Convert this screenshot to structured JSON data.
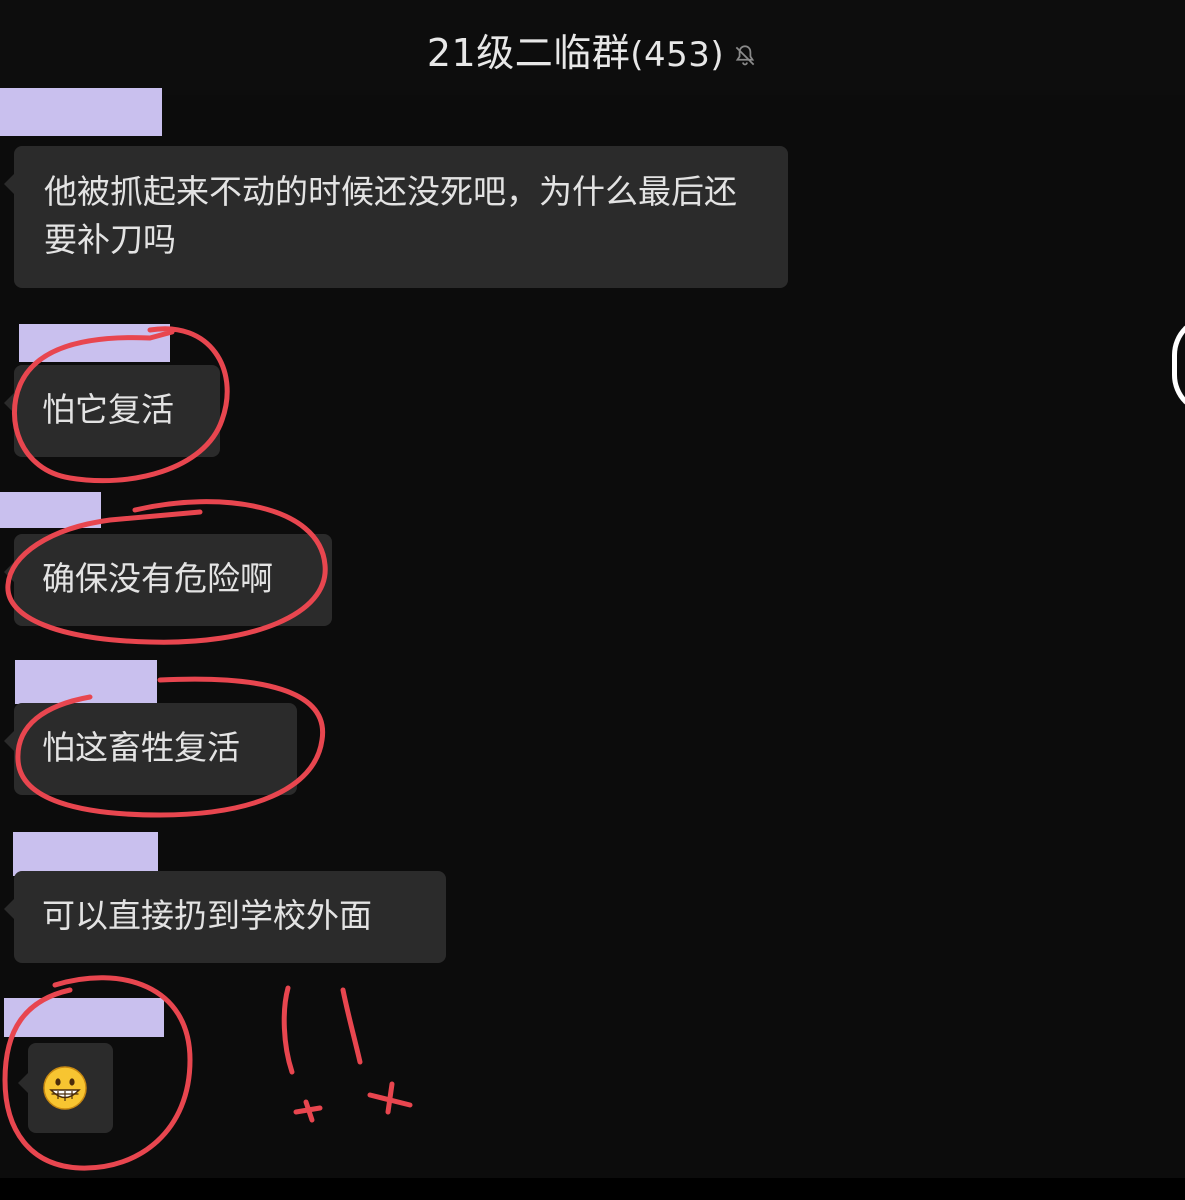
{
  "header": {
    "group_name": "21级二临群",
    "member_count": "(453)",
    "mute_icon": "bell-off-icon"
  },
  "messages": [
    {
      "text": "他被抓起来不动的时候还没死吧，为什么最后还要补刀吗"
    },
    {
      "text": "怕它复活"
    },
    {
      "text": "确保没有危险啊"
    },
    {
      "text": "怕这畜牲复活"
    },
    {
      "text": "可以直接扔到学校外面"
    },
    {
      "emoji": "grinning-face-icon"
    }
  ],
  "colors": {
    "background": "#0c0c0c",
    "bubble": "#2b2b2b",
    "name_mask": "#c9c0ee",
    "annotation": "#e8464f"
  }
}
